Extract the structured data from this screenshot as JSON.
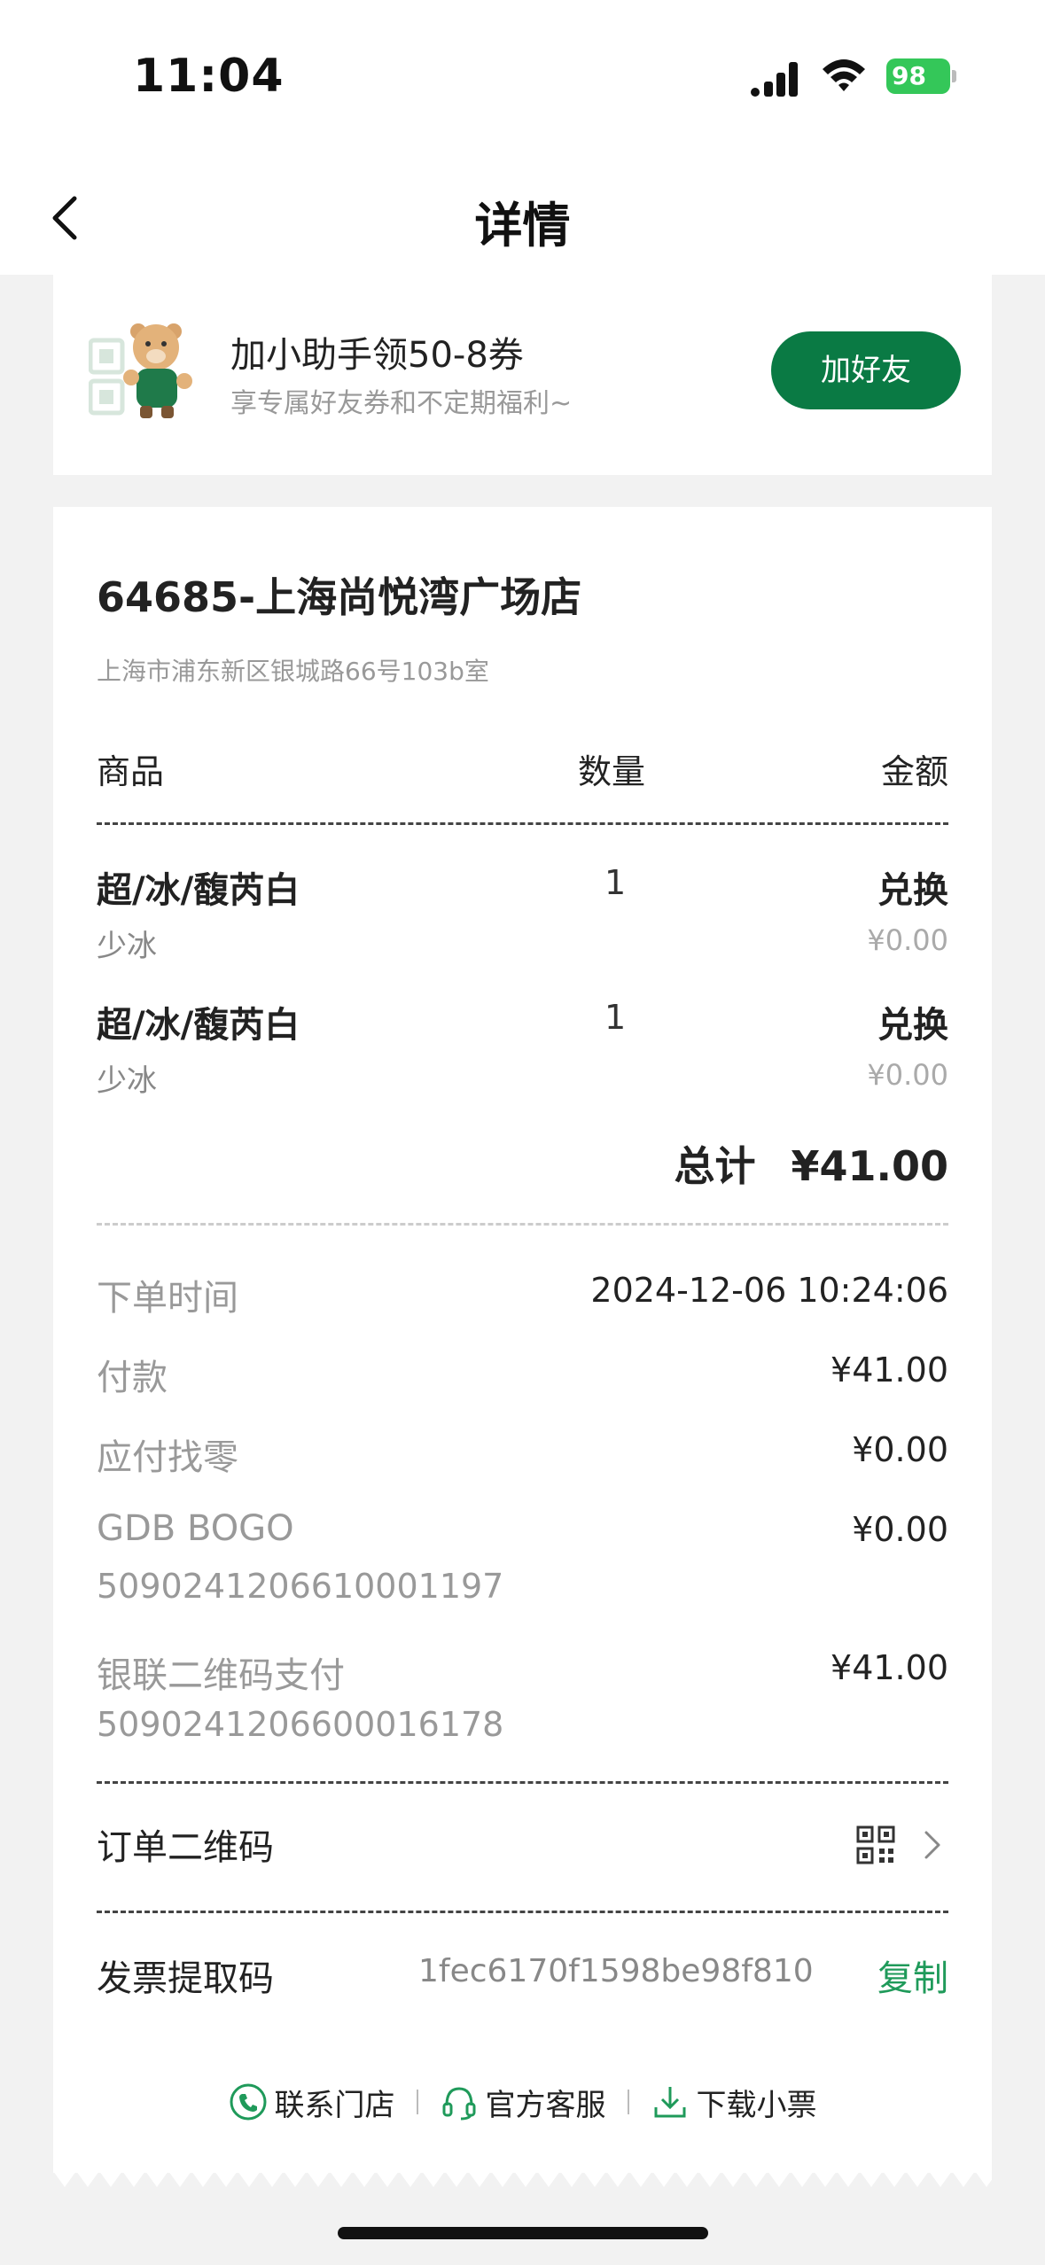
{
  "status": {
    "time": "11:04",
    "battery": "98"
  },
  "nav": {
    "title": "详情"
  },
  "promo": {
    "title": "加小助手领50-8券",
    "subtitle": "享专属好友券和不定期福利~",
    "button": "加好友"
  },
  "store": {
    "name": "64685-上海尚悦湾广场店",
    "address": "上海市浦东新区银城路66号103b室"
  },
  "table_headers": {
    "item": "商品",
    "qty": "数量",
    "amount": "金额"
  },
  "items": [
    {
      "name": "超/冰/馥芮白",
      "qty": "1",
      "price_label": "兑换",
      "option": "少冰",
      "price": "¥0.00"
    },
    {
      "name": "超/冰/馥芮白",
      "qty": "1",
      "price_label": "兑换",
      "option": "少冰",
      "price": "¥0.00"
    }
  ],
  "total": {
    "label": "总计",
    "value": "¥41.00"
  },
  "details": {
    "order_time_label": "下单时间",
    "order_time": "2024-12-06 10:24:06",
    "payment_label": "付款",
    "payment": "¥41.00",
    "change_label": "应付找零",
    "change": "¥0.00",
    "promo_label": "GDB BOGO",
    "promo_value": "¥0.00",
    "promo_code": "5090241206610001197",
    "unionpay_label": "银联二维码支付",
    "unionpay_value": "¥41.00",
    "unionpay_code": "5090241206600016178"
  },
  "order_qr_label": "订单二维码",
  "invoice": {
    "label": "发票提取码",
    "code": "1fec6170f1598be98f810",
    "copy": "复制"
  },
  "footer_links": {
    "store": "联系门店",
    "service": "官方客服",
    "download": "下载小票"
  },
  "colors": {
    "accent": "#0a7a44",
    "link_green": "#1f9a5a"
  }
}
